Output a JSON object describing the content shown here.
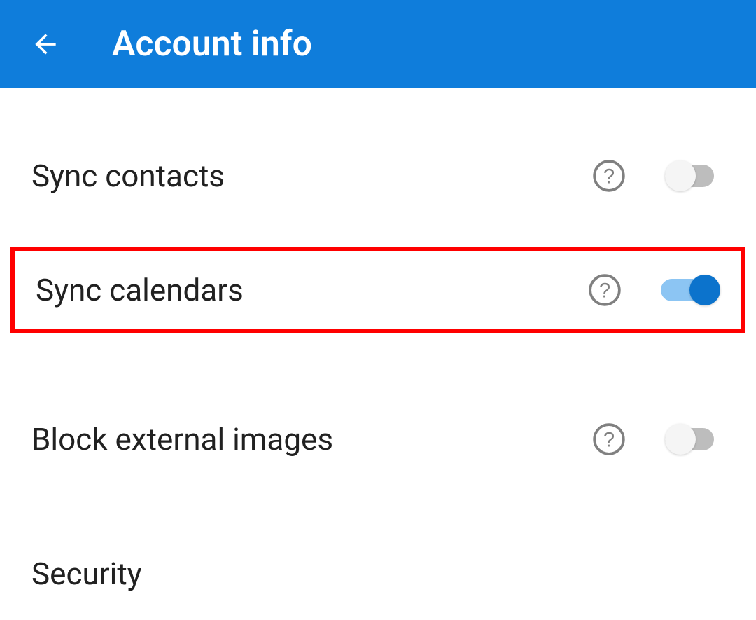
{
  "header": {
    "title": "Account info"
  },
  "settings": {
    "sync_contacts": {
      "label": "Sync contacts",
      "enabled": false,
      "highlighted": false
    },
    "sync_calendars": {
      "label": "Sync calendars",
      "enabled": true,
      "highlighted": true
    },
    "block_external_images": {
      "label": "Block external images",
      "enabled": false,
      "highlighted": false
    }
  },
  "sections": {
    "security": "Security"
  },
  "colors": {
    "header_bg": "#0F7DDB",
    "highlight_border": "#FF0000",
    "toggle_on_track": "#8CC5F3",
    "toggle_on_knob": "#0C73CC",
    "toggle_off_track": "#BDBDBD",
    "toggle_off_knob": "#F5F5F5"
  }
}
